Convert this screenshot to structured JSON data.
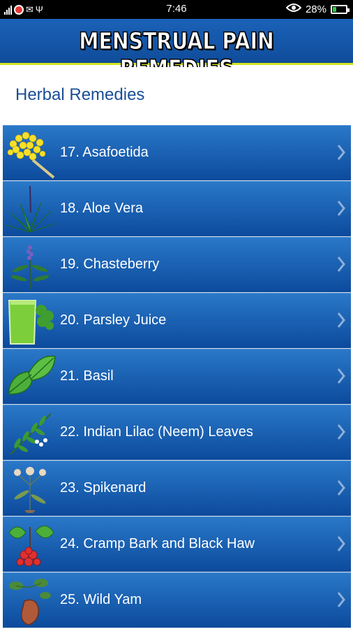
{
  "status_bar": {
    "time": "7:46",
    "battery": "28%",
    "battery_level": 0.28,
    "icons": [
      "signal-icon",
      "notification-dot-icon",
      "mail-icon",
      "usb-icon",
      "eye-icon",
      "battery-icon"
    ]
  },
  "app": {
    "title": "MENSTRUAL PAIN REMEDIES"
  },
  "section": {
    "title": "Herbal Remedies"
  },
  "colors": {
    "header": "#1b62b8",
    "header_underline": "#d3e51f",
    "row": "#1a62b4",
    "section_text": "#1a4f96"
  },
  "items": [
    {
      "label": "17. Asafoetida",
      "icon": "asafoetida-flower-icon"
    },
    {
      "label": "18. Aloe Vera",
      "icon": "aloe-vera-icon"
    },
    {
      "label": "19. Chasteberry",
      "icon": "chasteberry-plant-icon"
    },
    {
      "label": "20. Parsley Juice",
      "icon": "parsley-juice-icon"
    },
    {
      "label": "21. Basil",
      "icon": "basil-leaf-icon"
    },
    {
      "label": "22. Indian Lilac (Neem) Leaves",
      "icon": "neem-leaves-icon"
    },
    {
      "label": "23. Spikenard",
      "icon": "spikenard-plant-icon"
    },
    {
      "label": "24. Cramp Bark and Black Haw",
      "icon": "cramp-bark-berries-icon"
    },
    {
      "label": "25. Wild Yam",
      "icon": "wild-yam-icon"
    }
  ]
}
